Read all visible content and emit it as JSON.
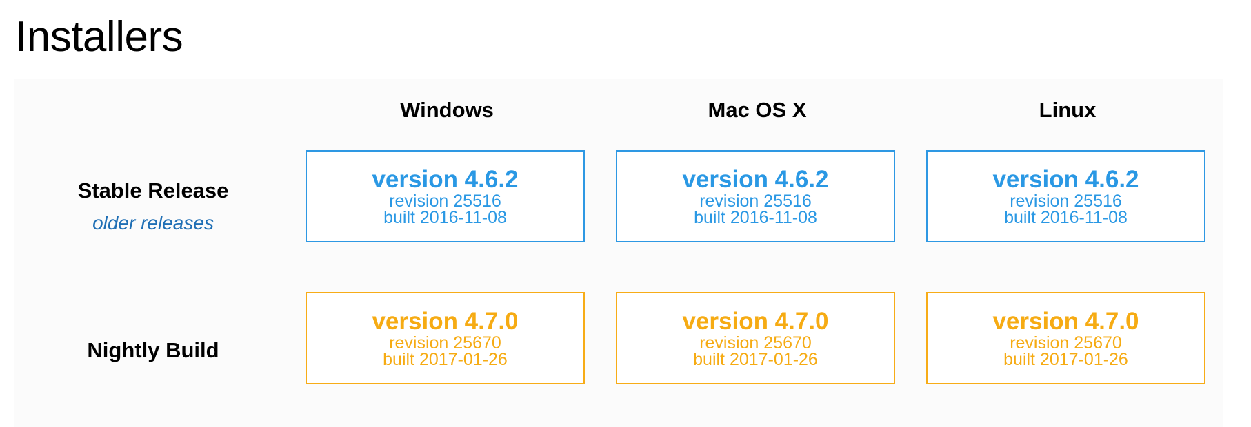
{
  "title": "Installers",
  "columns": [
    "Windows",
    "Mac OS X",
    "Linux"
  ],
  "rows": {
    "stable": {
      "label": "Stable Release",
      "link": "older releases",
      "color": "#2a98e4",
      "cells": [
        {
          "version": "version 4.6.2",
          "revision": "revision 25516",
          "built": "built 2016-11-08"
        },
        {
          "version": "version 4.6.2",
          "revision": "revision 25516",
          "built": "built 2016-11-08"
        },
        {
          "version": "version 4.6.2",
          "revision": "revision 25516",
          "built": "built 2016-11-08"
        }
      ]
    },
    "nightly": {
      "label": "Nightly Build",
      "color": "#f6ab13",
      "cells": [
        {
          "version": "version 4.7.0",
          "revision": "revision 25670",
          "built": "built 2017-01-26"
        },
        {
          "version": "version 4.7.0",
          "revision": "revision 25670",
          "built": "built 2017-01-26"
        },
        {
          "version": "version 4.7.0",
          "revision": "revision 25670",
          "built": "built 2017-01-26"
        }
      ]
    }
  }
}
